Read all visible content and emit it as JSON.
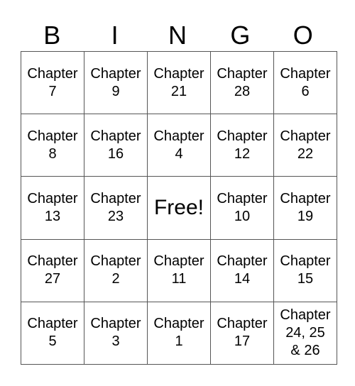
{
  "header": [
    "B",
    "I",
    "N",
    "G",
    "O"
  ],
  "rows": [
    [
      "Chapter\n7",
      "Chapter\n9",
      "Chapter\n21",
      "Chapter\n28",
      "Chapter\n6"
    ],
    [
      "Chapter\n8",
      "Chapter\n16",
      "Chapter\n4",
      "Chapter\n12",
      "Chapter\n22"
    ],
    [
      "Chapter\n13",
      "Chapter\n23",
      "Free!",
      "Chapter\n10",
      "Chapter\n19"
    ],
    [
      "Chapter\n27",
      "Chapter\n2",
      "Chapter\n11",
      "Chapter\n14",
      "Chapter\n15"
    ],
    [
      "Chapter\n5",
      "Chapter\n3",
      "Chapter\n1",
      "Chapter\n17",
      "Chapter\n24, 25\n& 26"
    ]
  ]
}
